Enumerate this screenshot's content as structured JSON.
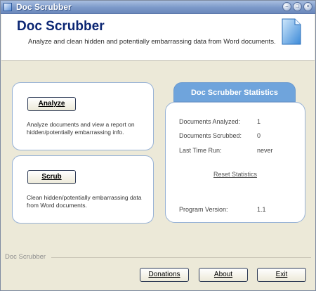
{
  "window": {
    "title": "Doc Scrubber",
    "controls": [
      "–",
      "□",
      "×"
    ]
  },
  "header": {
    "title": "Doc Scrubber",
    "subtitle": "Analyze and clean hidden and potentially embarrassing data from Word documents."
  },
  "analyze": {
    "button_label": "Analyze",
    "description": "Analyze documents and view a report on hidden/potentially embarrassing info."
  },
  "scrub": {
    "button_label": "Scrub",
    "description": "Clean hidden/potentially embarrassing data from Word documents."
  },
  "stats": {
    "title": "Doc Scrubber Statistics",
    "documents_analyzed_label": "Documents Analyzed:",
    "documents_analyzed_value": "1",
    "documents_scrubbed_label": "Documents Scrubbed:",
    "documents_scrubbed_value": "0",
    "last_time_run_label": "Last Time Run:",
    "last_time_run_value": "never",
    "reset_label": "Reset Statistics",
    "program_version_label": "Program Version:",
    "program_version_value": "1.1"
  },
  "footer": {
    "group_label": "Doc Scrubber",
    "donations_label": "Donations",
    "about_label": "About",
    "exit_label": "Exit"
  },
  "icons": {
    "app": "app-icon",
    "document": "document-icon"
  },
  "colors": {
    "title_blue": "#0b2673",
    "stats_tab": "#6fa4dc",
    "panel_border": "#97b2d6"
  }
}
